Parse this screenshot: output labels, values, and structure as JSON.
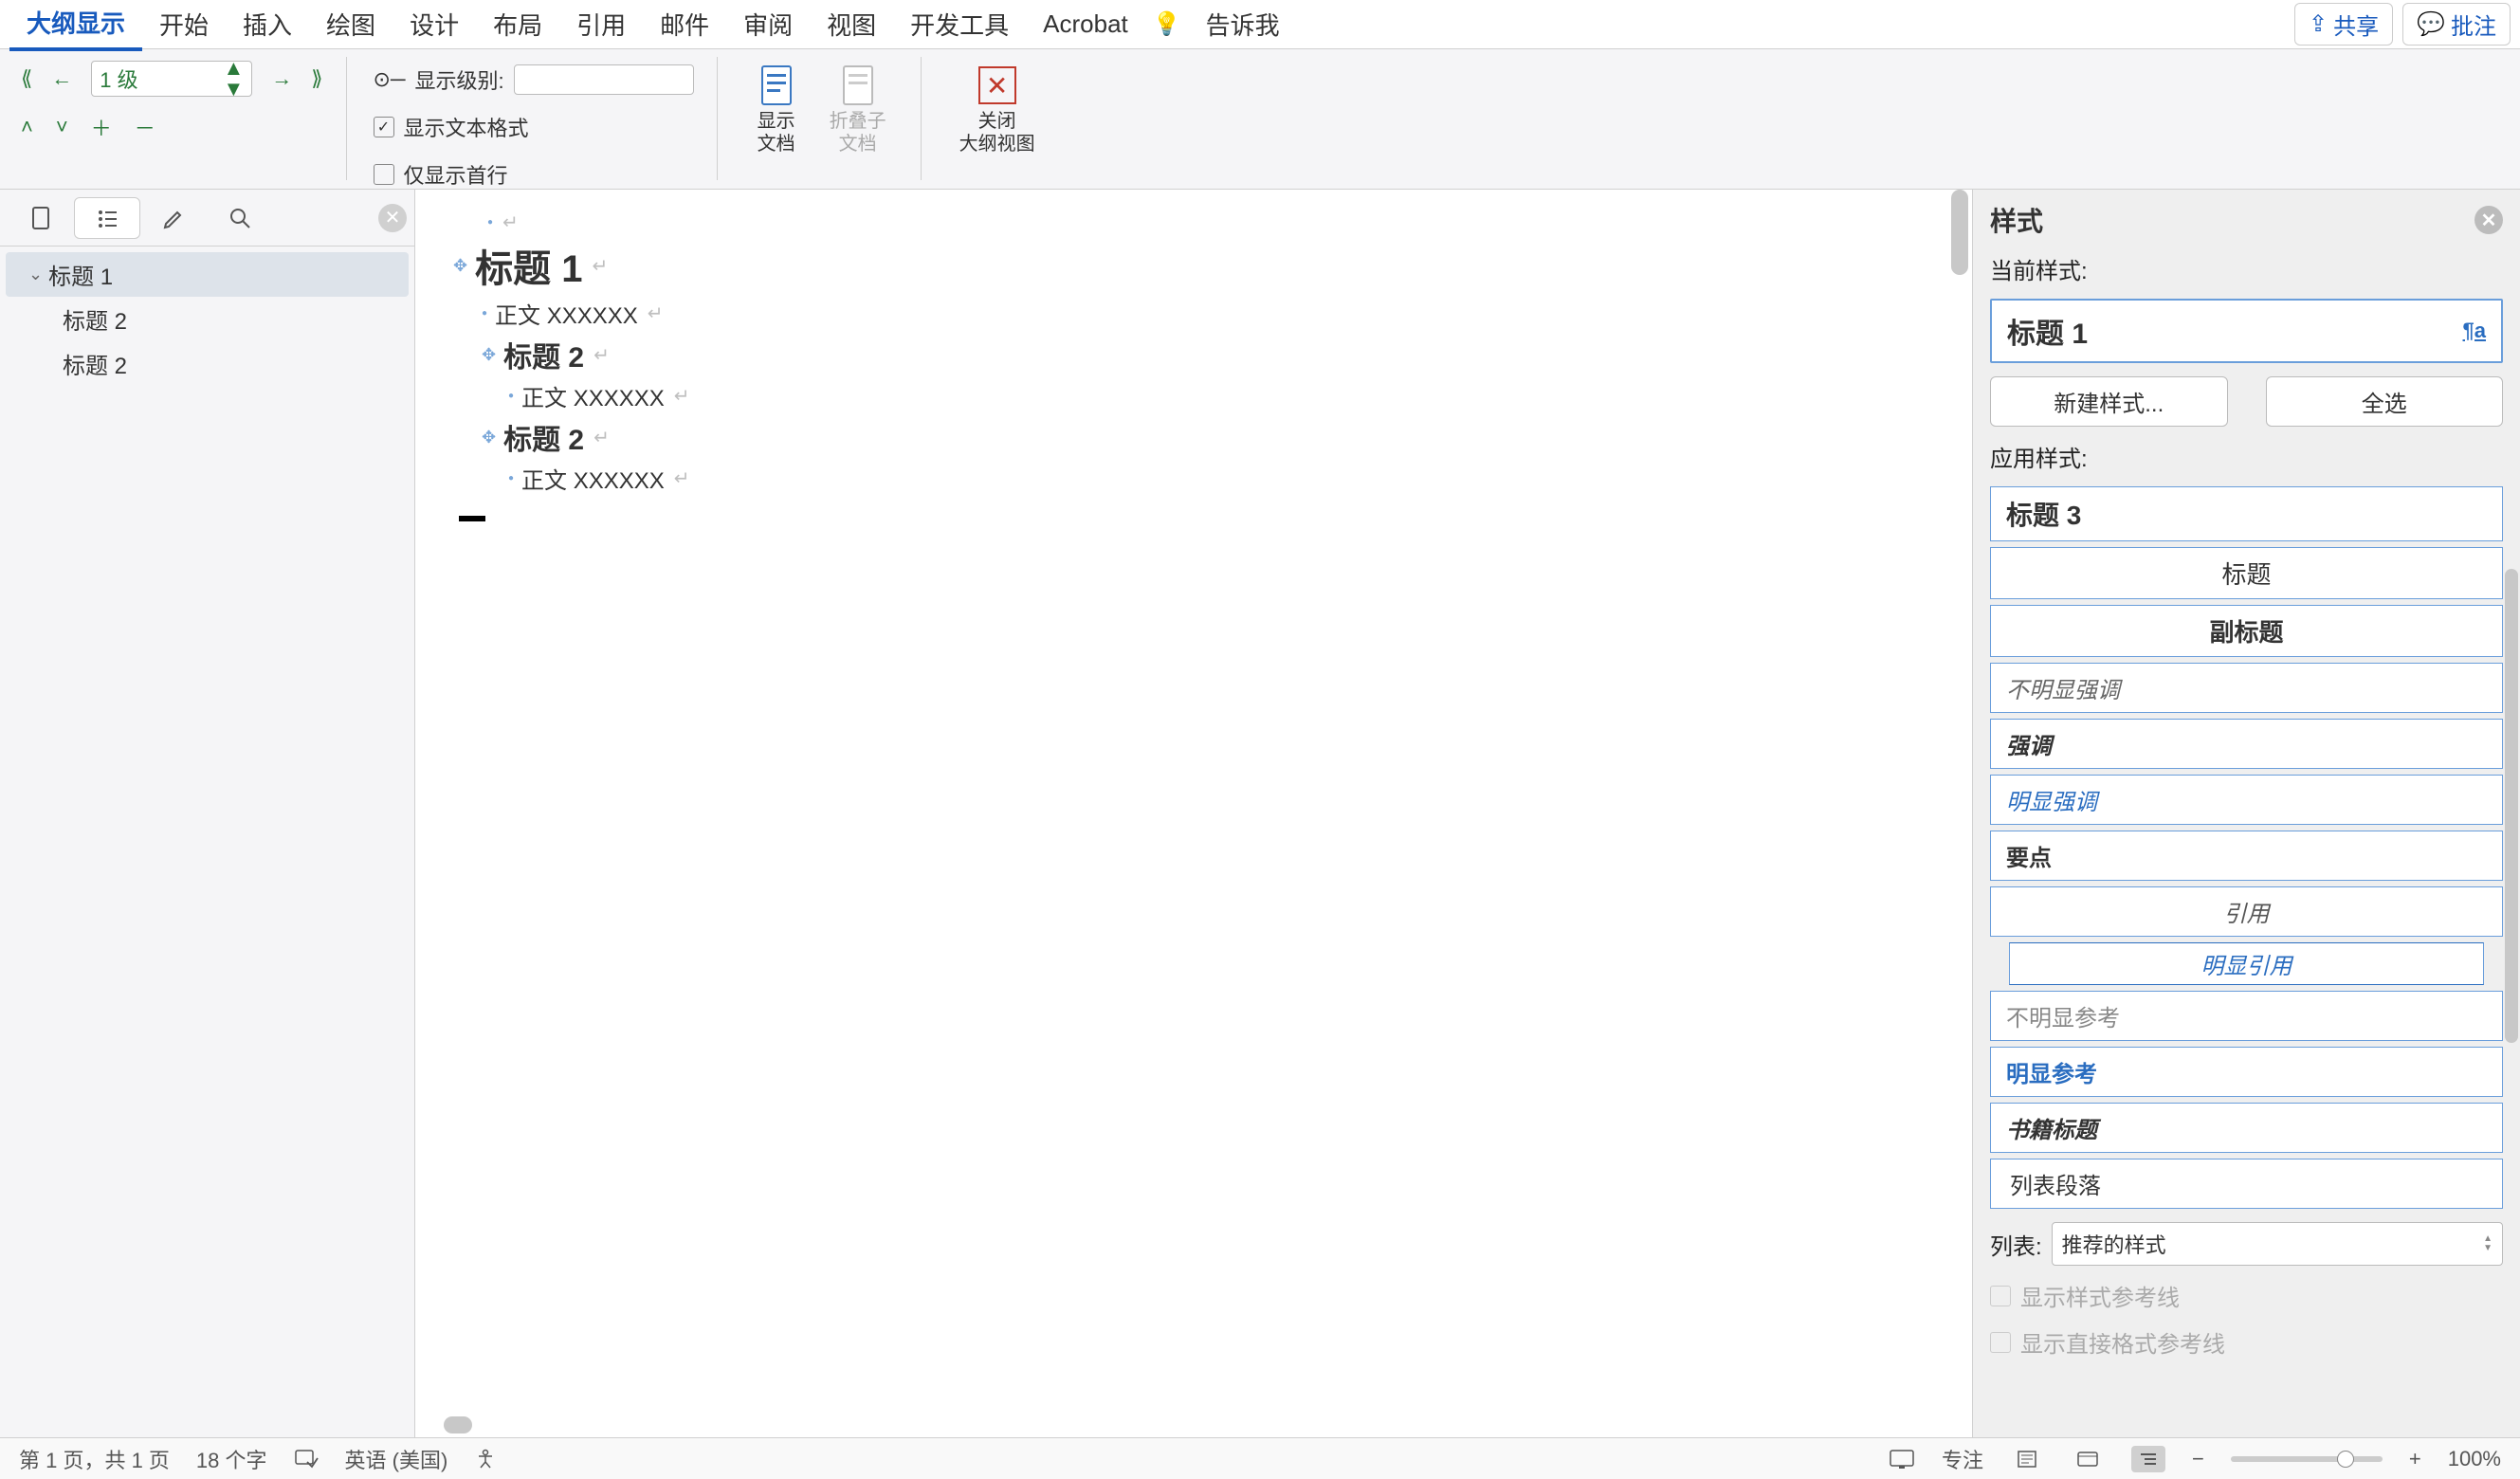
{
  "menu": {
    "tabs": [
      "大纲显示",
      "开始",
      "插入",
      "绘图",
      "设计",
      "布局",
      "引用",
      "邮件",
      "审阅",
      "视图",
      "开发工具",
      "Acrobat"
    ],
    "tell_me": "告诉我",
    "share": "共享",
    "comments": "批注"
  },
  "ribbon": {
    "level_value": "1 级",
    "show_level": "显示级别:",
    "show_text_fmt": "显示文本格式",
    "first_line_only": "仅显示首行",
    "show_doc": "显示\n文档",
    "collapse_sub": "折叠子\n文档",
    "close_outline": "关闭\n大纲视图"
  },
  "nav": {
    "items": [
      {
        "label": "标题 1",
        "level": 1,
        "selected": true,
        "expandable": true
      },
      {
        "label": "标题 2",
        "level": 2,
        "selected": false
      },
      {
        "label": "标题 2",
        "level": 2,
        "selected": false
      }
    ]
  },
  "doc": {
    "lines": [
      {
        "type": "h1",
        "text": "标题 1",
        "indent": 0,
        "grip": true
      },
      {
        "type": "body",
        "text": "正文 XXXXXX",
        "indent": 1,
        "grip": false
      },
      {
        "type": "h2",
        "text": "标题 2",
        "indent": 1,
        "grip": true
      },
      {
        "type": "body",
        "text": "正文 XXXXXX",
        "indent": 2,
        "grip": false
      },
      {
        "type": "h2",
        "text": "标题 2",
        "indent": 1,
        "grip": true
      },
      {
        "type": "body",
        "text": "正文 XXXXXX",
        "indent": 2,
        "grip": false
      }
    ]
  },
  "styles": {
    "title": "样式",
    "current_label": "当前样式:",
    "current_name": "标题 1",
    "new_style": "新建样式...",
    "select_all": "全选",
    "apply_label": "应用样式:",
    "items": [
      {
        "label": "标题 3",
        "cls": "si-h3"
      },
      {
        "label": "标题",
        "cls": "si-title"
      },
      {
        "label": "副标题",
        "cls": "si-subtitle"
      },
      {
        "label": "不明显强调",
        "cls": "si-subtle-em"
      },
      {
        "label": "强调",
        "cls": "si-em"
      },
      {
        "label": "明显强调",
        "cls": "si-strong-em"
      },
      {
        "label": "要点",
        "cls": "si-strong"
      },
      {
        "label": "引用",
        "cls": "si-quote"
      },
      {
        "label": "明显引用",
        "cls": "si-intense-quote"
      },
      {
        "label": "不明显参考",
        "cls": "si-subtle-ref"
      },
      {
        "label": "明显参考",
        "cls": "si-intense-ref"
      },
      {
        "label": "书籍标题",
        "cls": "si-book"
      },
      {
        "label": "列表段落",
        "cls": "si-list-para"
      }
    ],
    "list_label": "列表:",
    "list_value": "推荐的样式",
    "show_guides": "显示样式参考线",
    "show_direct_guides": "显示直接格式参考线"
  },
  "status": {
    "page": "第 1 页，共 1 页",
    "words": "18 个字",
    "lang": "英语 (美国)",
    "focus": "专注",
    "zoom": "100%"
  }
}
